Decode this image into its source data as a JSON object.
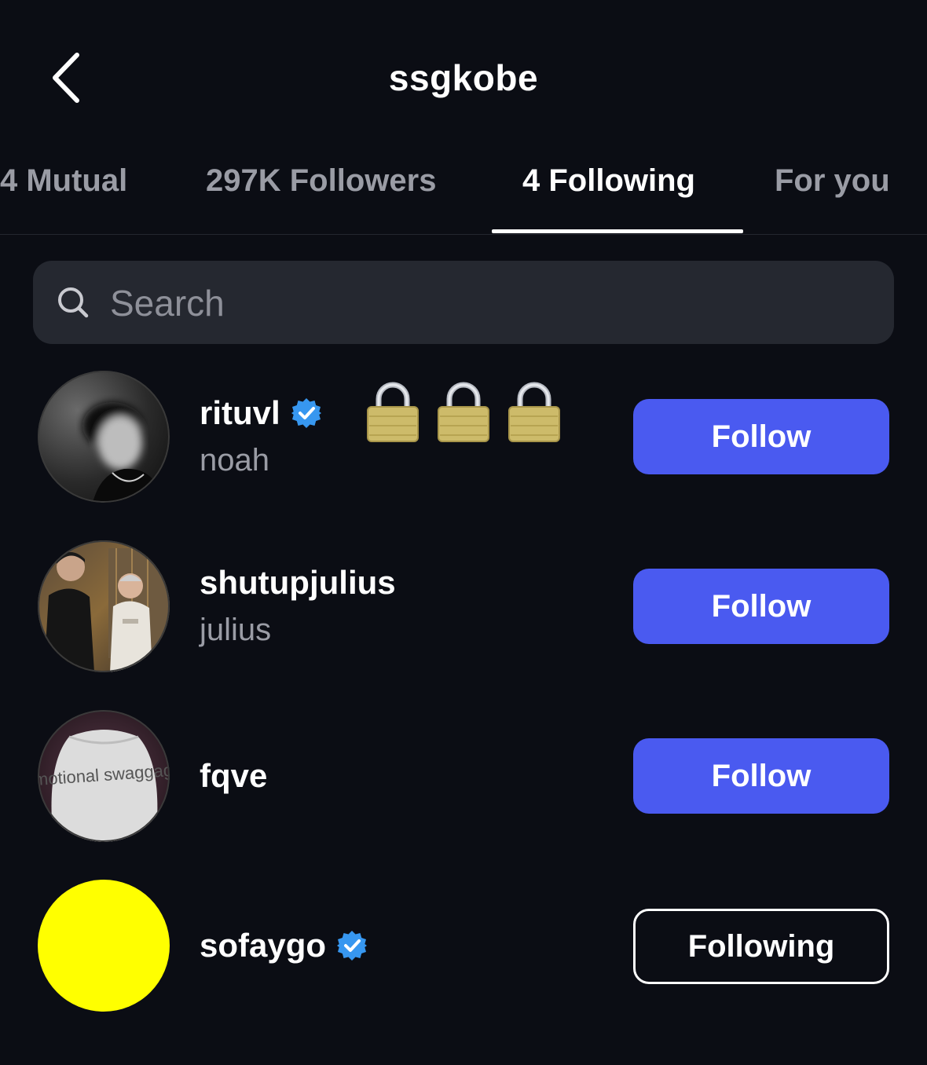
{
  "header": {
    "title": "ssgkobe",
    "back_icon": "chevron-left-icon"
  },
  "tabs": [
    {
      "label": "4 Mutual",
      "active": false
    },
    {
      "label": "297K Followers",
      "active": false
    },
    {
      "label": "4 Following",
      "active": true
    },
    {
      "label": "For you",
      "active": false
    }
  ],
  "search": {
    "placeholder": "Search",
    "value": "",
    "icon": "search-icon"
  },
  "users": [
    {
      "username": "rituvl",
      "fullname": "noah",
      "verified": true,
      "emoji": "🔒🔒🔒",
      "button": "Follow",
      "avatar": "grayscale blurred portrait"
    },
    {
      "username": "shutupjulius",
      "fullname": "julius",
      "verified": false,
      "button": "Follow",
      "avatar": "two people photo"
    },
    {
      "username": "fqve",
      "fullname": "",
      "verified": false,
      "button": "Follow",
      "avatar": "shirt with text",
      "avatar_text": "emotional swaggage"
    },
    {
      "username": "sofaygo",
      "fullname": "",
      "verified": true,
      "button": "Following",
      "avatar": "solid yellow"
    }
  ],
  "colors": {
    "background": "#0b0d14",
    "follow_button": "#4a5af0",
    "verified_badge": "#3797f0",
    "avatar_yellow": "#ffff00",
    "search_bg": "#252830",
    "muted_text": "#9a9ca5"
  }
}
